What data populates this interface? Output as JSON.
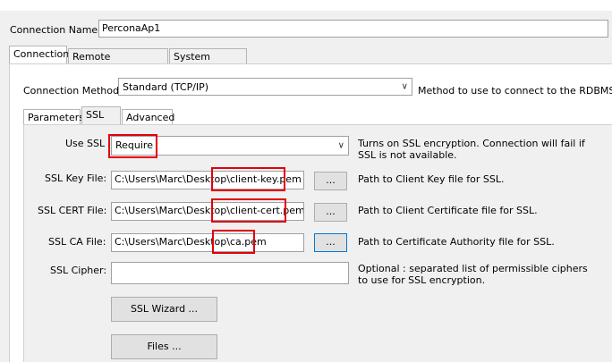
{
  "connection_name": {
    "label": "Connection Name:",
    "value": "PerconaAp1"
  },
  "main_tabs": [
    {
      "label": "Connection"
    },
    {
      "label": "Remote Management"
    },
    {
      "label": "System Profile"
    }
  ],
  "connection_method": {
    "label": "Connection Method:",
    "value": "Standard (TCP/IP)",
    "description": "Method to use to connect to the RDBMS"
  },
  "sub_tabs": [
    {
      "label": "Parameters"
    },
    {
      "label": "SSL"
    },
    {
      "label": "Advanced"
    }
  ],
  "ssl": {
    "use_ssl": {
      "label": "Use SSL",
      "value": "Require",
      "description": "Turns on SSL encryption. Connection will fail if SSL is not available."
    },
    "key_file": {
      "label": "SSL Key File:",
      "path_prefix": "C:\\Users\\Marc\\Desktop\\",
      "filename": "client-key.pem",
      "browse": "...",
      "description": "Path to Client Key file for SSL."
    },
    "cert_file": {
      "label": "SSL CERT File:",
      "path_prefix": "C:\\Users\\Marc\\Desktop\\",
      "filename": "client-cert.pem",
      "browse": "...",
      "description": "Path to Client Certificate file for SSL."
    },
    "ca_file": {
      "label": "SSL CA File:",
      "path_prefix": "C:\\Users\\Marc\\Desktop\\",
      "filename": "ca.pem",
      "browse": "...",
      "description": "Path to Certificate Authority file for SSL."
    },
    "cipher": {
      "label": "SSL Cipher:",
      "value": "",
      "description": "Optional : separated list of permissible ciphers to use for SSL encryption."
    },
    "wizard_button": "SSL Wizard ...",
    "files_button": "Files ..."
  },
  "highlight_color": "#e3000b"
}
